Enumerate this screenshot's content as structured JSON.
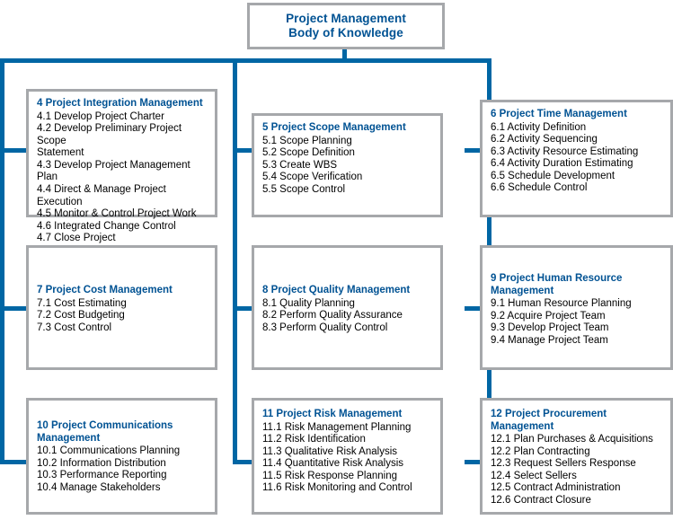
{
  "diagram": {
    "accent_color": "#0066a4",
    "title_text_color": "#005293",
    "box_border_color": "#a6a8ab",
    "background_color": "#ffffff"
  },
  "root": {
    "line1": "Project Management",
    "line2": "Body of Knowledge"
  },
  "knowledge_areas": [
    {
      "id": "integration",
      "title": "4 Project Integration Management",
      "items": [
        "4.1 Develop Project Charter",
        "4.2 Develop Preliminary Project Scope\nStatement",
        "4.3 Develop Project Management Plan",
        "4.4 Direct & Manage Project Execution",
        "4.5 Monitor & Control Project Work",
        "4.6 Integrated Change Control",
        "4.7 Close Project"
      ]
    },
    {
      "id": "scope",
      "title": "5 Project Scope Management",
      "items": [
        "5.1 Scope Planning",
        "5.2 Scope Definition",
        "5.3 Create WBS",
        "5.4 Scope Verification",
        "5.5 Scope Control"
      ]
    },
    {
      "id": "time",
      "title": "6 Project Time Management",
      "items": [
        "6.1 Activity Definition",
        "6.2 Activity Sequencing",
        "6.3 Activity Resource Estimating",
        "6.4 Activity Duration Estimating",
        "6.5 Schedule Development",
        "6.6 Schedule Control"
      ]
    },
    {
      "id": "cost",
      "title": "7 Project Cost Management",
      "items": [
        "7.1 Cost Estimating",
        "7.2 Cost Budgeting",
        "7.3 Cost Control"
      ]
    },
    {
      "id": "quality",
      "title": "8 Project Quality Management",
      "items": [
        "8.1 Quality Planning",
        "8.2 Perform Quality Assurance",
        "8.3 Perform Quality Control"
      ]
    },
    {
      "id": "human-resource",
      "title": "9 Project Human Resource\nManagement",
      "items": [
        "9.1 Human Resource Planning",
        "9.2 Acquire Project Team",
        "9.3 Develop Project Team",
        "9.4 Manage Project Team"
      ]
    },
    {
      "id": "communications",
      "title": "10 Project Communications\nManagement",
      "items": [
        "10.1 Communications Planning",
        "10.2 Information Distribution",
        "10.3 Performance Reporting",
        "10.4 Manage Stakeholders"
      ]
    },
    {
      "id": "risk",
      "title": "11 Project Risk Management",
      "items": [
        "11.1 Risk Management Planning",
        "11.2 Risk Identification",
        "11.3 Qualitative Risk Analysis",
        "11.4 Quantitative Risk Analysis",
        "11.5 Risk Response Planning",
        "11.6 Risk Monitoring and Control"
      ]
    },
    {
      "id": "procurement",
      "title": "12 Project Procurement\nManagement",
      "items": [
        "12.1 Plan Purchases & Acquisitions",
        "12.2 Plan Contracting",
        "12.3 Request Sellers Response",
        "12.4 Select Sellers",
        "12.5 Contract Administration",
        "12.6 Contract Closure"
      ]
    }
  ]
}
